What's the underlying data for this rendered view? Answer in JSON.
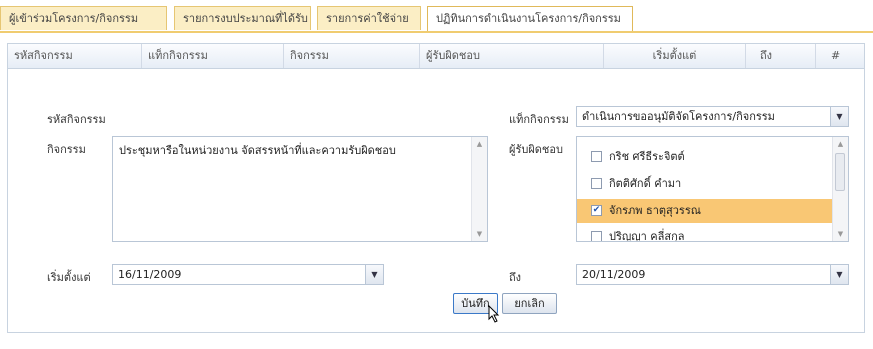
{
  "tabs": [
    {
      "label": "ผู้เข้าร่วมโครงการ/กิจกรรม"
    },
    {
      "label": "รายการงบประมาณที่ได้รับ"
    },
    {
      "label": "รายการค่าใช้จ่าย"
    },
    {
      "label": "ปฏิทินการดำเนินงานโครงการ/กิจกรรม",
      "active": true
    }
  ],
  "grid": {
    "columns": [
      "รหัสกิจกรรม",
      "แท็กกิจกรรม",
      "กิจกรรม",
      "ผู้รับผิดชอบ",
      "เริ่มตั้งแต่",
      "ถึง",
      "#"
    ]
  },
  "form": {
    "code_label": "รหัสกิจกรรม",
    "code_value": "",
    "tag_label": "แท็กกิจกรรม",
    "tag_value": "ดำเนินการขออนุมัติจัดโครงการ/กิจกรรม",
    "activity_label": "กิจกรรม",
    "activity_value": "ประชุมหารือในหน่วยงาน จัดสรรหน้าที่และความรับผิดชอบ",
    "responsible_label": "ผู้รับผิดชอบ",
    "responsible_options": [
      {
        "name": "กริช ศรีธีระจิตต์",
        "checked": false
      },
      {
        "name": "กิตติศักดิ์ คำมา",
        "checked": false
      },
      {
        "name": "จักรภพ ธาตุสุวรรณ",
        "checked": true
      },
      {
        "name": "ปริญญา คลี่สกุล",
        "checked": false
      }
    ],
    "start_label": "เริ่มตั้งแต่",
    "start_value": "16/11/2009",
    "end_label": "ถึง",
    "end_value": "20/11/2009"
  },
  "actions": {
    "save_label": "บันทึก",
    "cancel_label": "ยกเลิก"
  },
  "colors": {
    "tab_bg": "#fbeec5",
    "selected_row": "#f9c774",
    "border": "#b9c6d6"
  }
}
